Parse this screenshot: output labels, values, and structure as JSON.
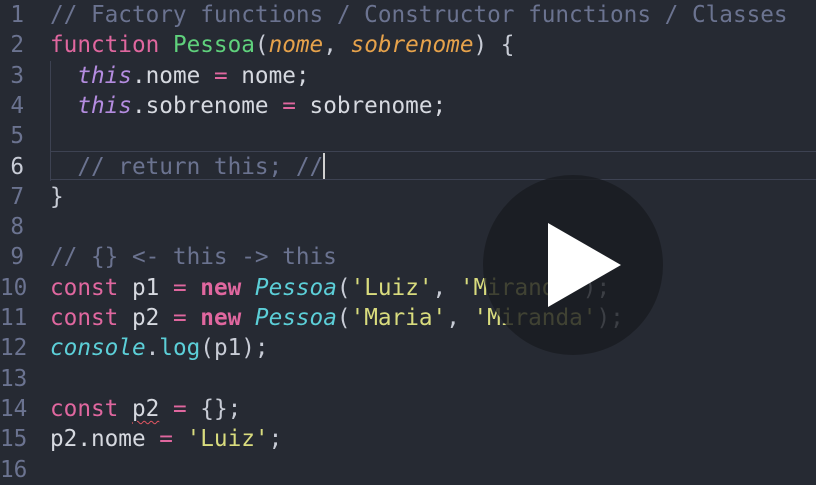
{
  "colors": {
    "comment": "#6b7390",
    "keyword": "#e0679f",
    "function": "#5fd17c",
    "param": "#e6a24b",
    "this": "#b48ce0",
    "plain": "#d6d9e0",
    "operator": "#e0679f",
    "class": "#5ccfd8",
    "string": "#d9dc7e",
    "console": "#5ccfd8",
    "method": "#5ccfd8",
    "punct": "#c8ccd6"
  },
  "active_line": 6,
  "lines": [
    {
      "n": "1",
      "tokens": [
        {
          "t": "// Factory functions / Constructor functions / Classes",
          "c": "comment"
        }
      ]
    },
    {
      "n": "2",
      "tokens": [
        {
          "t": "function ",
          "c": "keyword"
        },
        {
          "t": "Pessoa",
          "c": "function"
        },
        {
          "t": "(",
          "c": "punct"
        },
        {
          "t": "nome",
          "c": "param",
          "i": true
        },
        {
          "t": ", ",
          "c": "punct"
        },
        {
          "t": "sobrenome",
          "c": "param",
          "i": true
        },
        {
          "t": ") {",
          "c": "punct"
        }
      ]
    },
    {
      "n": "3",
      "tokens": [
        {
          "t": "  "
        },
        {
          "t": "this",
          "c": "this",
          "i": true
        },
        {
          "t": ".nome ",
          "c": "plain"
        },
        {
          "t": "=",
          "c": "operator"
        },
        {
          "t": " nome;",
          "c": "plain"
        }
      ]
    },
    {
      "n": "4",
      "tokens": [
        {
          "t": "  "
        },
        {
          "t": "this",
          "c": "this",
          "i": true
        },
        {
          "t": ".sobrenome ",
          "c": "plain"
        },
        {
          "t": "=",
          "c": "operator"
        },
        {
          "t": " sobrenome;",
          "c": "plain"
        }
      ]
    },
    {
      "n": "5",
      "tokens": []
    },
    {
      "n": "6",
      "tokens": [
        {
          "t": "  // return this; //",
          "c": "comment"
        }
      ]
    },
    {
      "n": "7",
      "tokens": [
        {
          "t": "}",
          "c": "punct"
        }
      ]
    },
    {
      "n": "8",
      "tokens": []
    },
    {
      "n": "9",
      "tokens": [
        {
          "t": "// {} <- this -> this",
          "c": "comment"
        }
      ]
    },
    {
      "n": "10",
      "tokens": [
        {
          "t": "const ",
          "c": "keyword"
        },
        {
          "t": "p1 ",
          "c": "plain"
        },
        {
          "t": "= ",
          "c": "operator"
        },
        {
          "t": "new ",
          "c": "keyword",
          "b": true
        },
        {
          "t": "Pessoa",
          "c": "class",
          "i": true
        },
        {
          "t": "(",
          "c": "punct"
        },
        {
          "t": "'Luiz'",
          "c": "string"
        },
        {
          "t": ", ",
          "c": "punct"
        },
        {
          "t": "'Miranda'",
          "c": "string"
        },
        {
          "t": ");",
          "c": "punct"
        }
      ]
    },
    {
      "n": "11",
      "tokens": [
        {
          "t": "const ",
          "c": "keyword"
        },
        {
          "t": "p2 ",
          "c": "plain"
        },
        {
          "t": "= ",
          "c": "operator"
        },
        {
          "t": "new ",
          "c": "keyword",
          "b": true
        },
        {
          "t": "Pessoa",
          "c": "class",
          "i": true
        },
        {
          "t": "(",
          "c": "punct"
        },
        {
          "t": "'Maria'",
          "c": "string"
        },
        {
          "t": ", ",
          "c": "punct"
        },
        {
          "t": "'Miranda'",
          "c": "string"
        },
        {
          "t": ");",
          "c": "punct"
        }
      ]
    },
    {
      "n": "12",
      "tokens": [
        {
          "t": "console",
          "c": "console",
          "i": true
        },
        {
          "t": ".",
          "c": "punct"
        },
        {
          "t": "log",
          "c": "method"
        },
        {
          "t": "(p1);",
          "c": "punct"
        }
      ]
    },
    {
      "n": "13",
      "tokens": []
    },
    {
      "n": "14",
      "tokens": [
        {
          "t": "const ",
          "c": "keyword"
        },
        {
          "t": "p2",
          "c": "plain",
          "err": true
        },
        {
          "t": " ",
          "c": "plain"
        },
        {
          "t": "= ",
          "c": "operator"
        },
        {
          "t": "{};",
          "c": "punct"
        }
      ]
    },
    {
      "n": "15",
      "tokens": [
        {
          "t": "p2.nome ",
          "c": "plain"
        },
        {
          "t": "= ",
          "c": "operator"
        },
        {
          "t": "'Luiz'",
          "c": "string"
        },
        {
          "t": ";",
          "c": "punct"
        }
      ]
    },
    {
      "n": "16",
      "tokens": []
    }
  ],
  "overlay": {
    "icon": "play-icon"
  }
}
